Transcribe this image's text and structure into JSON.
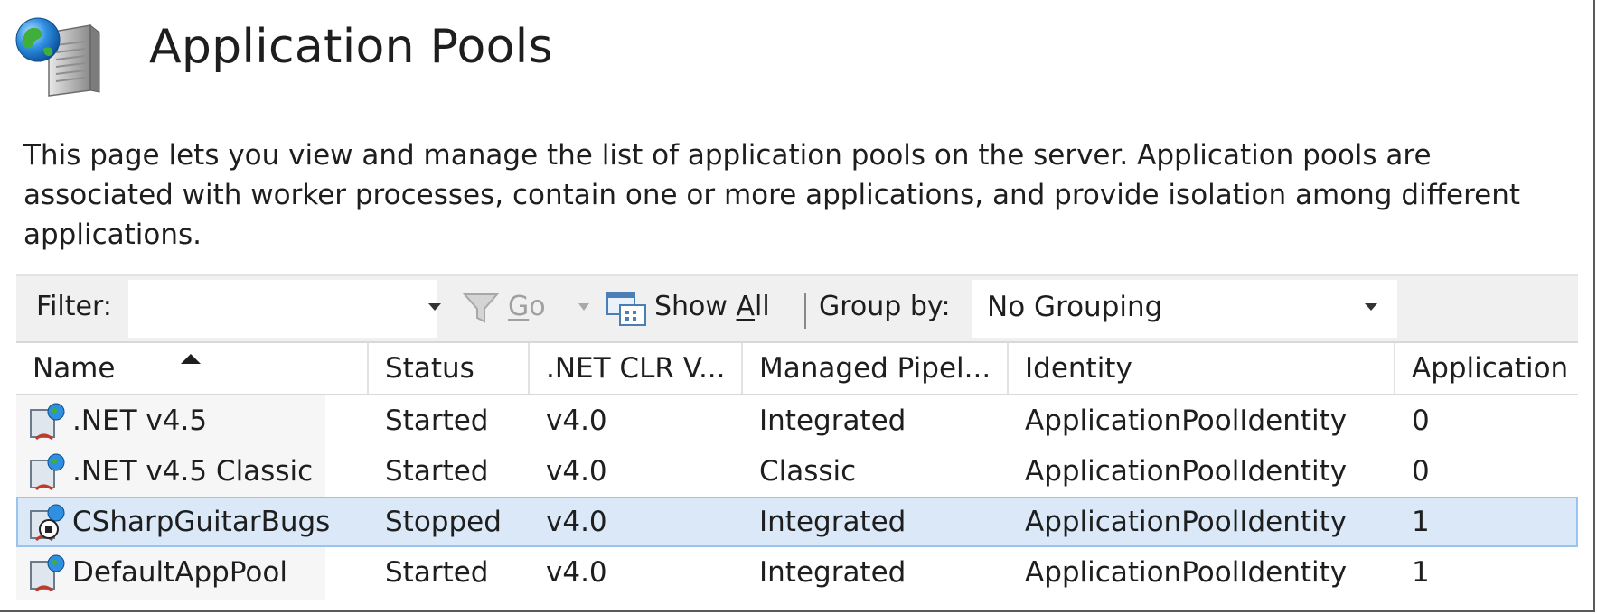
{
  "header": {
    "title": "Application Pools",
    "description": "This page lets you view and manage the list of application pools on the server. Application pools are associated with worker processes, contain one or more applications, and provide isolation among different applications.",
    "icon": "server-globe-icon"
  },
  "toolbar": {
    "filter_label": "Filter:",
    "filter_value": "",
    "go_label_pre": "",
    "go_label_u": "G",
    "go_label_post": "o",
    "show_all_pre": "Show ",
    "show_all_u": "A",
    "show_all_post": "ll",
    "group_by_label": "Group by:",
    "group_by_value": "No Grouping"
  },
  "grid": {
    "columns": [
      "Name",
      "Status",
      ".NET CLR V...",
      "Managed Pipel...",
      "Identity",
      "Application"
    ],
    "sorted_column": "Name",
    "sort_direction": "ascending",
    "rows": [
      {
        "name": ".NET v4.5",
        "status": "Started",
        "clr": "v4.0",
        "pipeline": "Integrated",
        "identity": "ApplicationPoolIdentity",
        "applications": "0",
        "selected": false
      },
      {
        "name": ".NET v4.5 Classic",
        "status": "Started",
        "clr": "v4.0",
        "pipeline": "Classic",
        "identity": "ApplicationPoolIdentity",
        "applications": "0",
        "selected": false
      },
      {
        "name": "CSharpGuitarBugs",
        "status": "Stopped",
        "clr": "v4.0",
        "pipeline": "Integrated",
        "identity": "ApplicationPoolIdentity",
        "applications": "1",
        "selected": true
      },
      {
        "name": "DefaultAppPool",
        "status": "Started",
        "clr": "v4.0",
        "pipeline": "Integrated",
        "identity": "ApplicationPoolIdentity",
        "applications": "1",
        "selected": false
      }
    ]
  },
  "colors": {
    "selection": "#dae8f7",
    "selection_border": "#99c4ef",
    "toolbar_bg": "#f0f0f0"
  }
}
